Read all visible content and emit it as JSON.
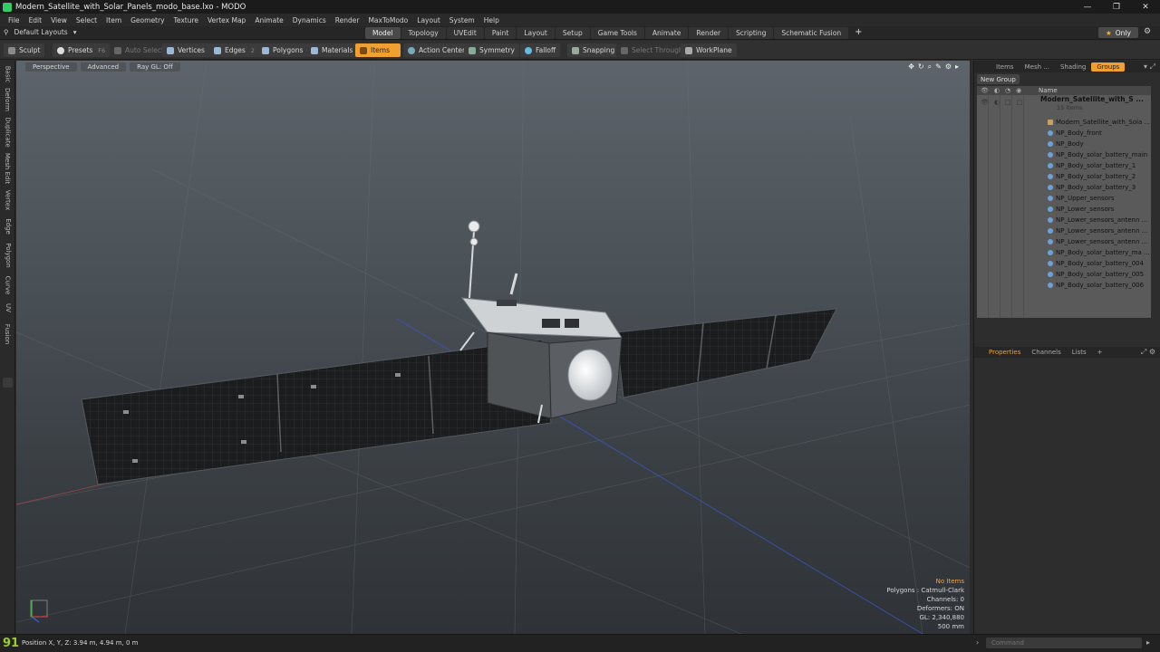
{
  "window": {
    "title": "Modern_Satellite_with_Solar_Panels_modo_base.lxo - MODO",
    "controls": [
      "—",
      "❐",
      "✕"
    ]
  },
  "menu": [
    "File",
    "Edit",
    "View",
    "Select",
    "Item",
    "Geometry",
    "Texture",
    "Vertex Map",
    "Animate",
    "Dynamics",
    "Render",
    "MaxToModo",
    "Layout",
    "System",
    "Help"
  ],
  "layoutbar": {
    "layout_label": "Default Layouts",
    "tabs": [
      "Model",
      "Topology",
      "UVEdit",
      "Paint",
      "Layout",
      "Setup",
      "Game Tools",
      "Animate",
      "Render",
      "Scripting",
      "Schematic Fusion"
    ],
    "active_tab": "Model",
    "only_label": "Only"
  },
  "toolbar": {
    "sculpt": "Sculpt",
    "presets": "Presets",
    "presets_key": "F6",
    "auto_select": "Auto Select",
    "vertices": "Vertices",
    "vertices_key": "1",
    "edges": "Edges",
    "edges_key": "2",
    "polygons": "Polygons",
    "polygons_key": "3",
    "materials": "Materials",
    "items": "Items",
    "action_center": "Action Center",
    "symmetry": "Symmetry",
    "falloff": "Falloff",
    "snapping": "Snapping",
    "select_through": "Select Through",
    "workplane": "WorkPlane"
  },
  "lefttabs": [
    "Basic",
    "Deform",
    "Duplicate",
    "Mesh Edit",
    "Vertex",
    "Edge",
    "Polygon",
    "Curve",
    "UV",
    "Fusion"
  ],
  "viewport": {
    "view_mode": "Perspective",
    "shading": "Advanced",
    "raygl": "Ray GL: Off",
    "stats": {
      "selection": "No Items",
      "polygons": "Polygons : Catmull-Clark",
      "channels": "Channels: 0",
      "deformers": "Deformers: ON",
      "gl": "GL: 2,340,880",
      "grid": "500 mm"
    }
  },
  "rightpanel": {
    "tabs": [
      "Items",
      "Mesh ...",
      "Shading",
      "Groups"
    ],
    "active_tab": "Groups",
    "new_group": "New Group",
    "name_header": "Name",
    "root_name": "Modern_Satellite_with_S ...",
    "root_count": "15 Items",
    "items": [
      "Modern_Satellite_with_Sola ...",
      "NP_Body_front",
      "NP_Body",
      "NP_Body_solar_battery_main",
      "NP_Body_solar_battery_1",
      "NP_Body_solar_battery_2",
      "NP_Body_solar_battery_3",
      "NP_Upper_sensors",
      "NP_Lower_sensors",
      "NP_Lower_sensors_antenn ...",
      "NP_Lower_sensors_antenn ...",
      "NP_Lower_sensors_antenn ...",
      "NP_Body_solar_battery_ma ...",
      "NP_Body_solar_battery_004",
      "NP_Body_solar_battery_005",
      "NP_Body_solar_battery_006"
    ],
    "lower_tabs": [
      "Properties",
      "Channels",
      "Lists"
    ],
    "lower_active": "Properties"
  },
  "statusbar": {
    "fps": "91",
    "position": "Position X, Y, Z:   3.94 m, 4.94 m, 0 m",
    "command_placeholder": "Command"
  },
  "colors": {
    "accent": "#f0a030",
    "fps_green": "#9ccf2a",
    "selection_warning": "#f2a440"
  }
}
